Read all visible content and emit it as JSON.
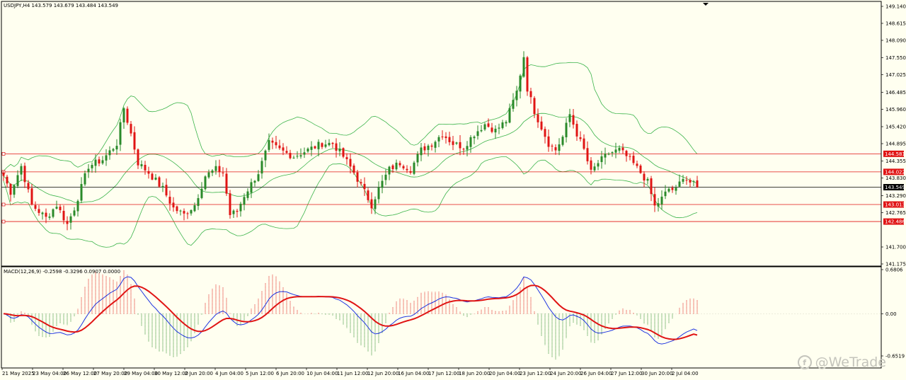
{
  "main_info": "USDJPY,H4  143.579 143.679 143.484 143.549",
  "macd_info": "MACD(12,26,9) -0.2598 -0.3296 0.0907 0.0000",
  "watermark": "@WeTrade",
  "colors": {
    "background": "#fffff0",
    "bull": "#2a8a2a",
    "bear": "#e01414",
    "bands": "#3cb44b",
    "hline": "#e01414",
    "macd_line": "#1f35e0",
    "signal_line": "#e01414",
    "price_tag": "#e01414"
  },
  "chart_data": [
    {
      "type": "candlestick",
      "title": "USDJPY,H4",
      "ylim": [
        141.175,
        149.14
      ],
      "price_axis_ticks": [
        "149.140",
        "148.615",
        "148.090",
        "147.550",
        "147.025",
        "146.485",
        "145.960",
        "145.420",
        "144.895",
        "144.355",
        "143.830",
        "143.290",
        "142.765",
        "141.700",
        "141.175"
      ],
      "time_axis_labels": [
        "21 May 2025",
        "23 May 04:00",
        "26 May 12:00",
        "27 May 20:00",
        "29 May 04:00",
        "30 May 12:00",
        "2 Jun 20:00",
        "4 Jun 04:00",
        "5 Jun 12:00",
        "6 Jun 20:00",
        "10 Jun 04:00",
        "11 Jun 12:00",
        "12 Jun 20:00",
        "16 Jun 04:00",
        "17 Jun 12:00",
        "18 Jun 20:00",
        "20 Jun 04:00",
        "23 Jun 12:00",
        "24 Jun 20:00",
        "26 Jun 04:00",
        "27 Jun 12:00",
        "30 Jun 20:00",
        "2 Jul 04:00"
      ],
      "horizontal_levels": [
        {
          "value": 144.581,
          "label": "144.581"
        },
        {
          "value": 144.022,
          "label": "144.022"
        },
        {
          "value": 143.013,
          "label": "143.013"
        },
        {
          "value": 142.486,
          "label": "142.486"
        }
      ],
      "current_price": {
        "value": 143.549,
        "label": "143.549"
      },
      "close_path": [
        {
          "bar": 0,
          "price": 143.9
        },
        {
          "bar": 2,
          "price": 143.4
        },
        {
          "bar": 5,
          "price": 144.2
        },
        {
          "bar": 8,
          "price": 143.0
        },
        {
          "bar": 12,
          "price": 142.6
        },
        {
          "bar": 15,
          "price": 143.0
        },
        {
          "bar": 18,
          "price": 142.4
        },
        {
          "bar": 20,
          "price": 142.9
        },
        {
          "bar": 24,
          "price": 144.2
        },
        {
          "bar": 28,
          "price": 144.4
        },
        {
          "bar": 32,
          "price": 144.9
        },
        {
          "bar": 34,
          "price": 146.0
        },
        {
          "bar": 36,
          "price": 145.2
        },
        {
          "bar": 38,
          "price": 144.3
        },
        {
          "bar": 41,
          "price": 144.0
        },
        {
          "bar": 45,
          "price": 143.5
        },
        {
          "bar": 48,
          "price": 142.9
        },
        {
          "bar": 51,
          "price": 142.7
        },
        {
          "bar": 54,
          "price": 143.0
        },
        {
          "bar": 57,
          "price": 143.9
        },
        {
          "bar": 60,
          "price": 144.1
        },
        {
          "bar": 62,
          "price": 144.0
        },
        {
          "bar": 64,
          "price": 142.7
        },
        {
          "bar": 66,
          "price": 142.8
        },
        {
          "bar": 68,
          "price": 143.3
        },
        {
          "bar": 72,
          "price": 144.0
        },
        {
          "bar": 75,
          "price": 144.9
        },
        {
          "bar": 78,
          "price": 144.7
        },
        {
          "bar": 82,
          "price": 144.5
        },
        {
          "bar": 86,
          "price": 144.7
        },
        {
          "bar": 90,
          "price": 144.9
        },
        {
          "bar": 93,
          "price": 144.9
        },
        {
          "bar": 96,
          "price": 144.5
        },
        {
          "bar": 99,
          "price": 144.0
        },
        {
          "bar": 101,
          "price": 143.6
        },
        {
          "bar": 104,
          "price": 143.0
        },
        {
          "bar": 106,
          "price": 143.5
        },
        {
          "bar": 109,
          "price": 144.1
        },
        {
          "bar": 112,
          "price": 144.3
        },
        {
          "bar": 115,
          "price": 144.1
        },
        {
          "bar": 118,
          "price": 144.7
        },
        {
          "bar": 121,
          "price": 144.9
        },
        {
          "bar": 124,
          "price": 145.2
        },
        {
          "bar": 127,
          "price": 144.9
        },
        {
          "bar": 130,
          "price": 144.8
        },
        {
          "bar": 133,
          "price": 145.2
        },
        {
          "bar": 136,
          "price": 145.5
        },
        {
          "bar": 139,
          "price": 145.3
        },
        {
          "bar": 142,
          "price": 145.6
        },
        {
          "bar": 145,
          "price": 146.5
        },
        {
          "bar": 147,
          "price": 147.6
        },
        {
          "bar": 148,
          "price": 146.6
        },
        {
          "bar": 150,
          "price": 145.9
        },
        {
          "bar": 152,
          "price": 145.4
        },
        {
          "bar": 154,
          "price": 144.9
        },
        {
          "bar": 156,
          "price": 144.7
        },
        {
          "bar": 158,
          "price": 145.1
        },
        {
          "bar": 160,
          "price": 145.8
        },
        {
          "bar": 162,
          "price": 145.2
        },
        {
          "bar": 164,
          "price": 144.7
        },
        {
          "bar": 166,
          "price": 144.0
        },
        {
          "bar": 168,
          "price": 144.3
        },
        {
          "bar": 171,
          "price": 144.6
        },
        {
          "bar": 174,
          "price": 144.7
        },
        {
          "bar": 177,
          "price": 144.4
        },
        {
          "bar": 180,
          "price": 144.0
        },
        {
          "bar": 182,
          "price": 143.7
        },
        {
          "bar": 184,
          "price": 142.95
        },
        {
          "bar": 186,
          "price": 143.2
        },
        {
          "bar": 188,
          "price": 143.5
        },
        {
          "bar": 190,
          "price": 143.45
        },
        {
          "bar": 192,
          "price": 143.9
        },
        {
          "bar": 194,
          "price": 143.7
        },
        {
          "bar": 196,
          "price": 143.549
        }
      ]
    },
    {
      "type": "macd",
      "title": "MACD(12,26,9)",
      "values": {
        "macd": -0.2598,
        "signal": -0.3296,
        "histogram": 0.0907
      },
      "ylim": [
        -0.6519,
        0.6806
      ],
      "price_axis_ticks": [
        "0.6806",
        "0.00",
        "-0.6519"
      ]
    }
  ]
}
